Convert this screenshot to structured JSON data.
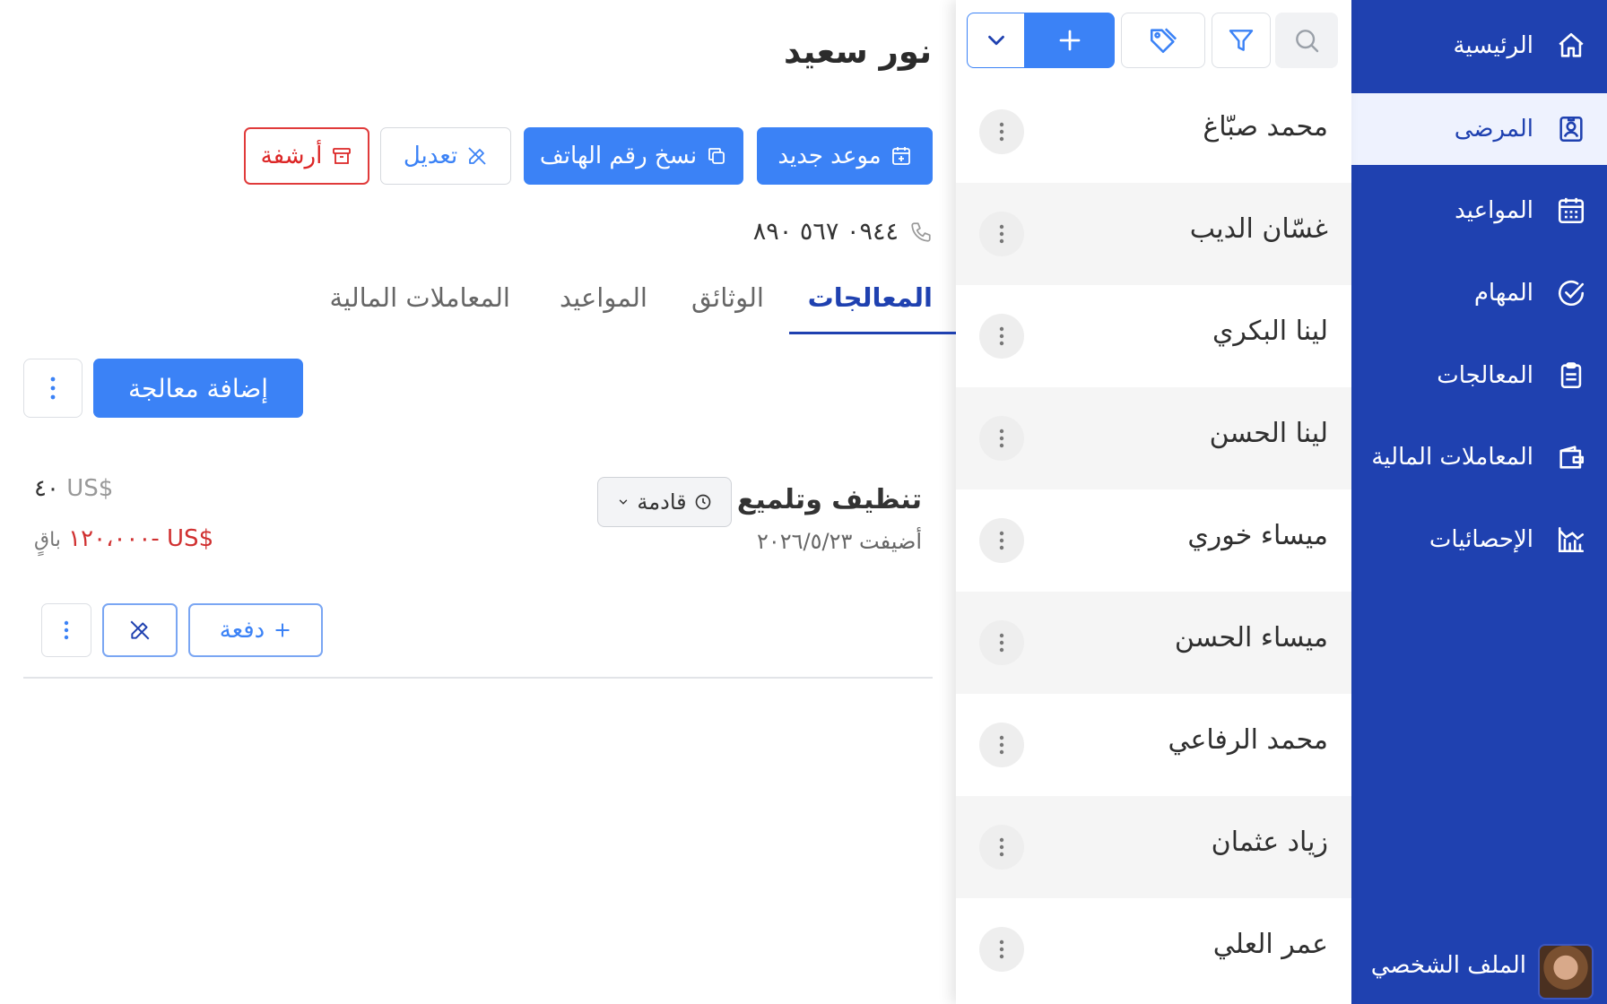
{
  "sidebar": {
    "items": [
      {
        "label": "الرئيسية",
        "icon": "home-icon"
      },
      {
        "label": "المرضى",
        "icon": "patient-badge-icon"
      },
      {
        "label": "المواعيد",
        "icon": "calendar-icon"
      },
      {
        "label": "المهام",
        "icon": "check-circle-icon"
      },
      {
        "label": "المعالجات",
        "icon": "clipboard-icon"
      },
      {
        "label": "المعاملات المالية",
        "icon": "wallet-icon"
      },
      {
        "label": "الإحصائيات",
        "icon": "stats-icon"
      }
    ],
    "active_index": 1,
    "profile_label": "الملف الشخصي"
  },
  "patients": [
    "محمد صبّاغ",
    "غسّان الديب",
    "لينا البكري",
    "لينا الحسن",
    "ميساء خوري",
    "ميساء الحسن",
    "محمد الرفاعي",
    "زياد عثمان",
    "عمر العلي"
  ],
  "patient": {
    "name": "نور سعيد",
    "phone": "٠٩٤٤ ٥٦٧ ٨٩٠",
    "actions": {
      "new_appointment": "موعد جديد",
      "copy_phone": "نسخ رقم الهاتف",
      "edit": "تعديل",
      "archive": "أرشفة"
    },
    "tabs": [
      "المعالجات",
      "الوثائق",
      "المواعيد",
      "المعاملات المالية"
    ],
    "active_tab": 0,
    "add_treatment": "إضافة معالجة"
  },
  "treatment": {
    "name": "تنظيف وتلميع",
    "status": "قادمة",
    "added": "أضيفت ٢٠٢٦/٥/٢٣",
    "price_amount": "٤٠",
    "currency": "$US",
    "remaining_label": "باقٍ",
    "remaining_amount": "-١٢٠،٠٠٠",
    "payment_button": "دفعة"
  },
  "colors": {
    "sidebar": "#1f41b0",
    "primary": "#3b82f6",
    "danger": "#dc2626"
  }
}
